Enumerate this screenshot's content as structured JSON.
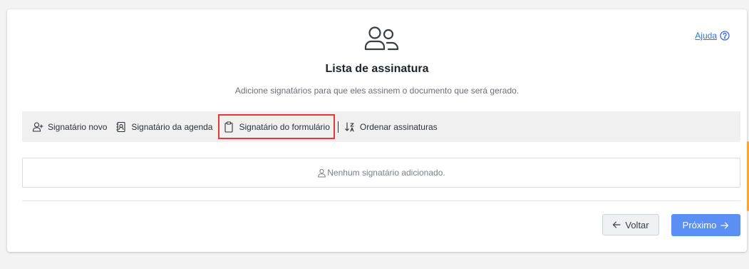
{
  "header": {
    "title": "Lista de assinatura",
    "subtitle": "Adicione signatários para que eles assinem o documento que será gerado.",
    "help_label": "Ajuda",
    "icon": "users-icon"
  },
  "toolbar": {
    "new_signer": "Signatário novo",
    "agenda_signer": "Signatário da agenda",
    "form_signer": "Signatário do formulário",
    "order_signatures": "Ordenar assinaturas"
  },
  "signers": {
    "empty_message": "Nenhum signatário adicionado."
  },
  "footer": {
    "back_label": "Voltar",
    "next_label": "Próximo"
  },
  "colors": {
    "primary": "#5b8ff4",
    "link": "#3d6ee0",
    "highlight": "#e53935",
    "accent": "#f4a63d"
  }
}
